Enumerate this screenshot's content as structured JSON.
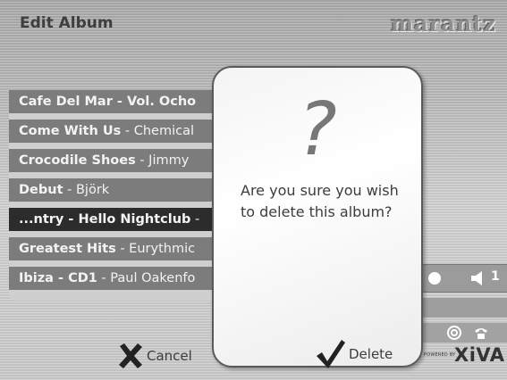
{
  "header": {
    "title": "Edit Album",
    "brand": "marantz"
  },
  "albums": [
    {
      "title": "Cafe Del Mar - Vol. Ocho",
      "artist": ""
    },
    {
      "title": "Come With Us",
      "artist": " - Chemical"
    },
    {
      "title": "Crocodile Shoes",
      "artist": " - Jimmy"
    },
    {
      "title": "Debut",
      "artist": " - Björk"
    },
    {
      "title": "...ntry - Hello Nightclub",
      "artist": " -"
    },
    {
      "title": "Greatest Hits",
      "artist": " - Eurythmic"
    },
    {
      "title": "Ibiza - CD1",
      "artist": " - Paul Oakenfo"
    }
  ],
  "dialog": {
    "symbol": "?",
    "message": "Are you sure you wish to delete this album?"
  },
  "buttons": {
    "cancel": "Cancel",
    "delete": "Delete"
  },
  "status": {
    "volume": "1",
    "powered_by": "POWERED BY",
    "brand_logo": "XiVA"
  },
  "icons": {
    "cancel": "x-icon",
    "delete": "checkmark-icon",
    "volume": "speaker-icon",
    "knob": "volume-knob-icon",
    "network": "network-icon",
    "phone": "phone-icon"
  }
}
